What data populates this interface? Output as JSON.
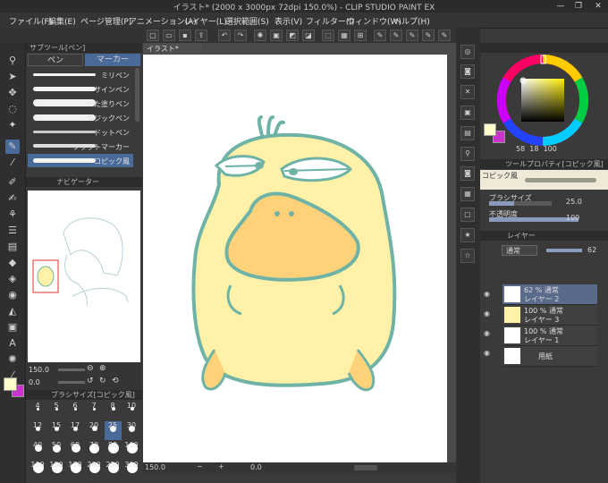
{
  "window": {
    "title": "イラスト* (2000 x 3000px 72dpi 150.0%) - CLIP STUDIO PAINT EX",
    "controls": [
      "—",
      "❐",
      "✕"
    ]
  },
  "menu": [
    "ファイル(F)",
    "編集(E)",
    "ページ管理(P)",
    "アニメーション(A)",
    "レイヤー(L)",
    "選択範囲(S)",
    "表示(V)",
    "フィルター(I)",
    "ウィンドウ(W)",
    "ヘルプ(H)"
  ],
  "subtool": {
    "header": "サブツール[ペン]",
    "tabs": [
      "ペン",
      "マーカー"
    ],
    "brushes": [
      "ミリペン",
      "サインペン",
      "べた塗りペン",
      "マジックペン",
      "ドットペン",
      "フラットマーカー",
      "コピック風"
    ]
  },
  "navigator": {
    "header": "ナビゲーター",
    "zoom": "150.0",
    "rotation": "0.0"
  },
  "brushsize": {
    "header": "ブラシサイズ[コピック風]",
    "sizes": [
      "4",
      "5",
      "6",
      "7",
      "8",
      "10",
      "12",
      "15",
      "17",
      "20",
      "25",
      "30",
      "40",
      "50",
      "60",
      "70",
      "80",
      "100",
      "120",
      "150",
      "170",
      "200",
      "250",
      "300"
    ],
    "selected": "25"
  },
  "canvas": {
    "tab": "イラスト*",
    "zoom": "150.0",
    "coord": "0.0"
  },
  "colors": {
    "main": "#ffffcc",
    "sub": "#cc33cc",
    "picked": "#efe9d7",
    "accent": "#4a6a9a",
    "duck_fill": "#fff2a8",
    "duck_line": "#6fb3a6",
    "beak": "#ffd27a"
  },
  "color_values": {
    "h": "58",
    "s": "18",
    "v": "100"
  },
  "toolprop": {
    "header": "ツールプロパティ[コピック風]",
    "brush_label": "コピック風",
    "size_label": "ブラシサイズ",
    "size_value": "25.0",
    "opacity_label": "不透明度",
    "opacity_value": "100"
  },
  "layers": {
    "header": "レイヤー",
    "blend_mode": "通常",
    "opacity": "62",
    "items": [
      {
        "mode": "62 % 通常",
        "name": "レイヤー 2",
        "selected": true
      },
      {
        "mode": "100 % 通常",
        "name": "レイヤー 3",
        "selected": false
      },
      {
        "mode": "100 % 通常",
        "name": "レイヤー 1",
        "selected": false
      },
      {
        "mode": "",
        "name": "用紙",
        "selected": false
      }
    ]
  }
}
